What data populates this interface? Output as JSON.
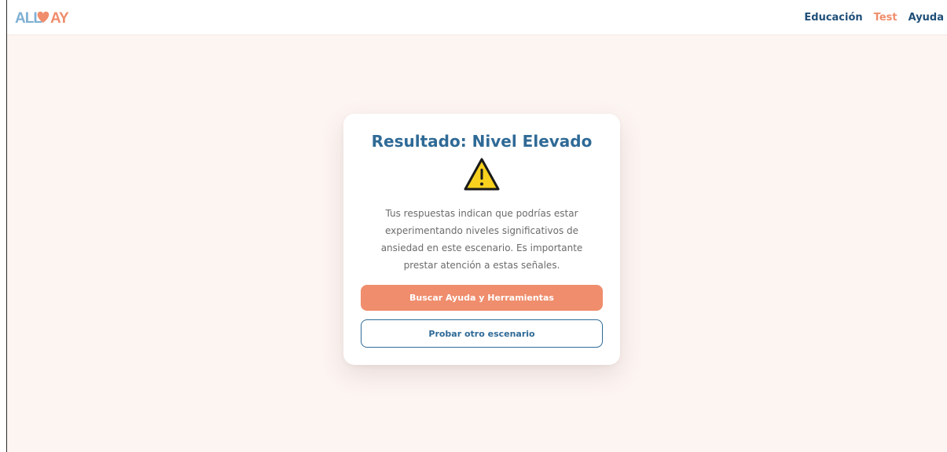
{
  "brand": {
    "logo_text": "ALLOPAY",
    "logo_colors": [
      "#7fb0d4",
      "#ef8d6c"
    ]
  },
  "nav": {
    "items": [
      {
        "label": "Educación",
        "active": false
      },
      {
        "label": "Test",
        "active": true
      },
      {
        "label": "Ayuda",
        "active": false
      }
    ]
  },
  "result": {
    "title": "Resultado: Nivel Elevado",
    "icon": "warning-triangle-icon",
    "message": "Tus respuestas indican que podrías estar experimentando niveles significativos de ansiedad en este escenario. Es importante prestar atención a estas señales.",
    "primary_button": "Buscar Ayuda y Herramientas",
    "secondary_button": "Probar otro escenario"
  },
  "colors": {
    "title_blue": "#2f6a96",
    "nav_blue": "#1f4f78",
    "accent_orange": "#ef8d6c",
    "warning_yellow": "#f7d11e",
    "page_bg": "#fdf5f2"
  }
}
